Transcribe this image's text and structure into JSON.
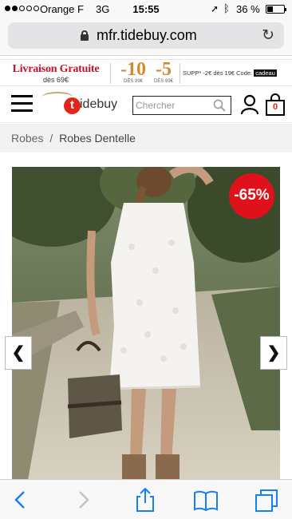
{
  "status_bar": {
    "carrier": "Orange F",
    "network": "3G",
    "time": "15:55",
    "battery": "36 %",
    "battery_level": 0.36
  },
  "browser": {
    "url": "mfr.tidebuy.com"
  },
  "promo": {
    "title": "Livraison Gratuite",
    "subtitle": "dès 69€",
    "discounts": [
      {
        "amount": "-10",
        "condition": "DÈS 99€"
      },
      {
        "amount": "-5",
        "condition": "DÈS 69€"
      }
    ],
    "supp_text": "SUPP* -2€ dès 19€  Code:",
    "code": "cadeau",
    "accent_color": "#c8102e"
  },
  "header": {
    "logo_letter": "t",
    "logo_text": "idebuy",
    "search_placeholder": "Chercher",
    "cart_count": "0"
  },
  "breadcrumb": {
    "parent": "Robes",
    "separator": "/",
    "current": "Robes Dentelle"
  },
  "product": {
    "discount": "-65%",
    "prev_label": "❮",
    "next_label": "❯"
  },
  "colors": {
    "badge": "#e0111b",
    "ios_blue": "#147efb"
  }
}
